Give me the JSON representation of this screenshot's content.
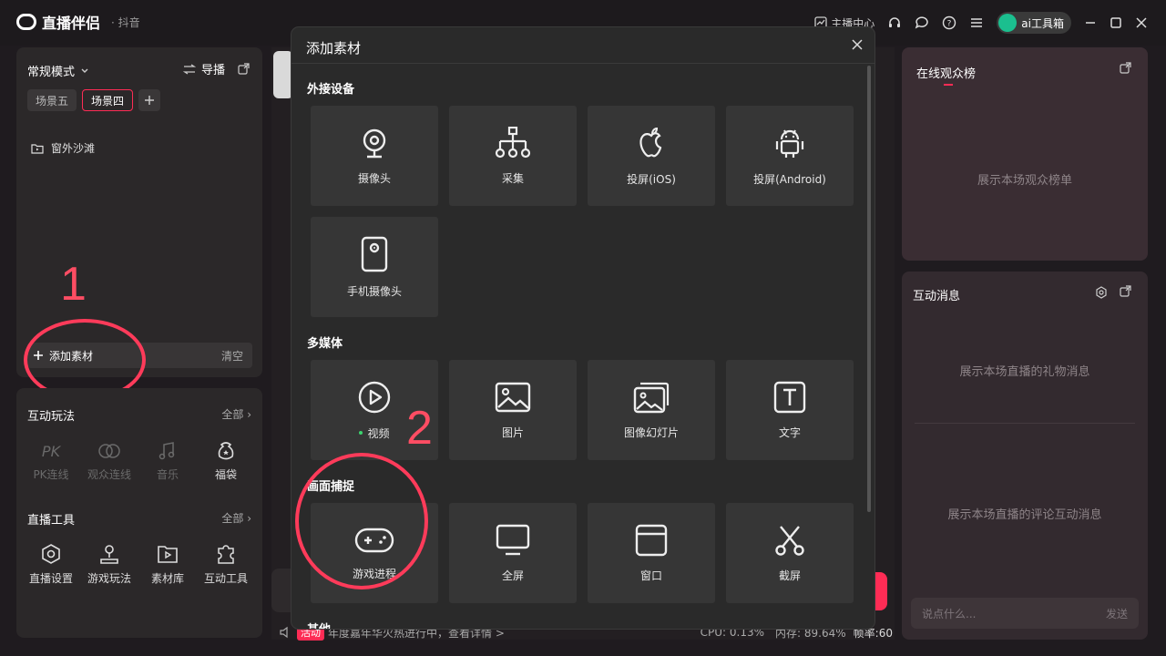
{
  "app": {
    "title": "直播伴侣",
    "subtitle": "· 抖音"
  },
  "titlebar": {
    "anchor_center": "主播中心",
    "ai_tools": "ai工具箱"
  },
  "left": {
    "mode": "常规模式",
    "guide": "导播",
    "tabs": [
      "场景五",
      "场景四"
    ],
    "scene_item": "窗外沙滩",
    "add_material": "添加素材",
    "clear": "清空",
    "annotation_1": "1",
    "interactive": {
      "title": "互动玩法",
      "all": "全部",
      "items": [
        "PK连线",
        "观众连线",
        "音乐",
        "福袋"
      ]
    },
    "tools": {
      "title": "直播工具",
      "all": "全部",
      "items": [
        "直播设置",
        "游戏玩法",
        "素材库",
        "互动工具"
      ]
    }
  },
  "status": {
    "tag": "活动",
    "text": "年度嘉年华火热进行中，查看详情 >",
    "cpu": "CPU: 0.13%",
    "mem": "内存: 89.64%",
    "fps": "帧率:60"
  },
  "right": {
    "rank_title": "在线观众榜",
    "rank_empty": "展示本场观众榜单",
    "msg_title": "互动消息",
    "gift_empty": "展示本场直播的礼物消息",
    "comment_empty": "展示本场直播的评论互动消息",
    "input_placeholder": "说点什么...",
    "send": "发送"
  },
  "modal": {
    "title": "添加素材",
    "sections": {
      "external": {
        "title": "外接设备",
        "items": [
          "摄像头",
          "采集",
          "投屏(iOS)",
          "投屏(Android)",
          "手机摄像头"
        ]
      },
      "media": {
        "title": "多媒体",
        "items": [
          "视频",
          "图片",
          "图像幻灯片",
          "文字"
        ]
      },
      "capture": {
        "title": "画面捕捉",
        "items": [
          "游戏进程",
          "全屏",
          "窗口",
          "截屏"
        ]
      },
      "other": {
        "title": "其他"
      }
    },
    "annotation_2": "2"
  },
  "colors": {
    "accent": "#fe2c55",
    "annotation": "#fe3b5a"
  }
}
